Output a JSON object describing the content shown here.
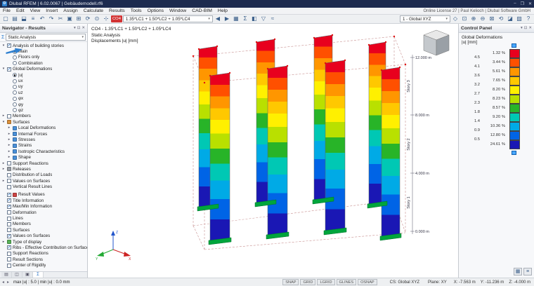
{
  "window": {
    "app_title": "Dlubal RFEM | 6.02.0067 | Gebäudemodell.rf6",
    "logo": "D",
    "minimize": "–",
    "maximize": "❐",
    "close": "✕"
  },
  "menubar": {
    "items": [
      "File",
      "Edit",
      "View",
      "Insert",
      "Assign",
      "Calculate",
      "Results",
      "Tools",
      "Options",
      "Window",
      "CAD-BIM",
      "Help"
    ],
    "license_text": "Online License 27 | Paul Kelioch | Dlubal Software GmbH"
  },
  "toolbar": {
    "left_icons": [
      {
        "name": "new-model",
        "g": "▢"
      },
      {
        "name": "open-model",
        "g": "▤"
      },
      {
        "name": "save-model",
        "g": "⬓"
      },
      {
        "name": "print",
        "g": "≡"
      },
      {
        "name": "undo",
        "g": "↶"
      },
      {
        "name": "redo",
        "g": "↷"
      },
      {
        "name": "cut",
        "g": "✂"
      },
      {
        "name": "copy",
        "g": "▣"
      },
      {
        "name": "table-grid",
        "g": "⊞"
      },
      {
        "name": "refresh",
        "g": "⟳"
      },
      {
        "name": "zoom",
        "g": "⊙"
      },
      {
        "name": "select",
        "g": "⊹"
      }
    ],
    "co_badge": "CO4",
    "load_combination": "1.35*LC1 + 1.50*LC2 + 1.05*LC4",
    "mid_icons": [
      {
        "name": "previous-case",
        "g": "◀"
      },
      {
        "name": "next-case",
        "g": "▶"
      },
      {
        "name": "calculate-all",
        "g": "▦"
      },
      {
        "name": "results-sum",
        "g": "Σ"
      },
      {
        "name": "show-results",
        "g": "◧"
      },
      {
        "name": "result-filter",
        "g": "▽"
      },
      {
        "name": "animation",
        "g": "≈"
      }
    ],
    "view_selector": "1 - Global XYZ",
    "right_icons": [
      {
        "name": "isometric-view",
        "g": "◇"
      },
      {
        "name": "zoom-window",
        "g": "⊡"
      },
      {
        "name": "zoom-in",
        "g": "⊕"
      },
      {
        "name": "zoom-out",
        "g": "⊖"
      },
      {
        "name": "fit-view",
        "g": "⊠"
      },
      {
        "name": "rotate-view",
        "g": "⟲"
      },
      {
        "name": "clipping",
        "g": "◪"
      },
      {
        "name": "render-mode",
        "g": "▨"
      },
      {
        "name": "help",
        "g": "?"
      }
    ]
  },
  "navigator": {
    "title": "Navigator - Results",
    "selector": "Static Analysis",
    "panel_icons": {
      "menu": "▾",
      "pin": "⊡",
      "close": "✕"
    },
    "tree": [
      {
        "t": "Analysis of building stories",
        "i": 0,
        "e": "o",
        "c": "cb1"
      },
      {
        "t": "Main",
        "i": 1,
        "c": "r1",
        "a": true
      },
      {
        "t": "Floors only",
        "i": 1,
        "c": "r0"
      },
      {
        "t": "Combination",
        "i": 1,
        "c": "r0"
      },
      {
        "t": "Global Deformations",
        "i": 0,
        "e": "o",
        "c": "cb1"
      },
      {
        "t": "|u|",
        "i": 1,
        "c": "r1"
      },
      {
        "t": "ux",
        "i": 1,
        "c": "r0"
      },
      {
        "t": "uy",
        "i": 1,
        "c": "r0"
      },
      {
        "t": "uz",
        "i": 1,
        "c": "r0"
      },
      {
        "t": "φx",
        "i": 1,
        "c": "r0"
      },
      {
        "t": "φy",
        "i": 1,
        "c": "r0"
      },
      {
        "t": "φz",
        "i": 1,
        "c": "r0"
      },
      {
        "t": "Members",
        "i": 0,
        "e": "c",
        "c": "cb0"
      },
      {
        "t": "Surfaces",
        "i": 0,
        "e": "o",
        "ic": "#d98f3a"
      },
      {
        "t": "Local Deformations",
        "i": 1,
        "e": "c",
        "ic": "#4a90d9"
      },
      {
        "t": "Internal Forces",
        "i": 1,
        "e": "c",
        "ic": "#4a90d9"
      },
      {
        "t": "Stresses",
        "i": 1,
        "e": "c",
        "ic": "#4a90d9"
      },
      {
        "t": "Strains",
        "i": 1,
        "e": "c",
        "ic": "#4a90d9"
      },
      {
        "t": "Isotropic Characteristics",
        "i": 1,
        "e": "c",
        "ic": "#4a90d9"
      },
      {
        "t": "Shape",
        "i": 1,
        "e": "c",
        "ic": "#4a90d9"
      },
      {
        "t": "Support Reactions",
        "i": 0,
        "e": "c",
        "c": "cb0"
      },
      {
        "t": "Releases",
        "i": 0,
        "e": "c",
        "ic": "#9aa0a8"
      },
      {
        "t": "Distribution of Loads",
        "i": 0,
        "c": "cb0"
      },
      {
        "t": "Values on Surfaces",
        "i": 0,
        "e": "c",
        "c": "cb0"
      },
      {
        "t": "Vertical Result Lines",
        "i": 0,
        "c": "cb0"
      },
      {
        "t": "Result Values",
        "i": 0,
        "c": "cb1",
        "ic": "#cc4444",
        "gap": true
      },
      {
        "t": "Title Information",
        "i": 0,
        "c": "cb1"
      },
      {
        "t": "Max/Min Information",
        "i": 0,
        "c": "cb1"
      },
      {
        "t": "Deformation",
        "i": 0,
        "c": "cb0"
      },
      {
        "t": "Lines",
        "i": 0,
        "c": "cb0"
      },
      {
        "t": "Members",
        "i": 0,
        "c": "cb0"
      },
      {
        "t": "Surfaces",
        "i": 0,
        "c": "cb0"
      },
      {
        "t": "Values on Surfaces",
        "i": 0,
        "c": "cb1"
      },
      {
        "t": "Type of display",
        "i": 0,
        "e": "c",
        "ic": "#57b257"
      },
      {
        "t": "Ribs - Effective Contribution on Surface/Me...",
        "i": 0,
        "c": "cb1"
      },
      {
        "t": "Support Reactions",
        "i": 0,
        "c": "cb0"
      },
      {
        "t": "Result Sections",
        "i": 0,
        "c": "cb0"
      },
      {
        "t": "Center of Rigidity",
        "i": 0,
        "c": "cb0"
      }
    ],
    "bottom_tabs": [
      {
        "name": "data",
        "g": "▤"
      },
      {
        "name": "display",
        "g": "◫"
      },
      {
        "name": "views",
        "g": "▣"
      },
      {
        "name": "results",
        "g": "Σ",
        "active": true
      }
    ]
  },
  "canvas": {
    "info1": "CO4 - 1.35*LC1 + 1.50*LC2 + 1.05*LC4",
    "info2": "Static Analysis",
    "info3": "Displacements |u| [mm]",
    "story_levels": [
      "12.000 m",
      "8.000 m",
      "4.000 m",
      "0.000 m"
    ],
    "story_names": [
      "Story 3",
      "Story 2",
      "Story 1"
    ],
    "axis": {
      "x": "X",
      "y": "Y",
      "z": "Z"
    }
  },
  "control_panel": {
    "title": "Control Panel",
    "subtitle1": "Global Deformations",
    "subtitle2": "|u| [mm]",
    "legend": {
      "colors": [
        "#e8001e",
        "#ff5000",
        "#ff9600",
        "#ffc800",
        "#fff000",
        "#b9e000",
        "#28b428",
        "#00c8b4",
        "#00aae6",
        "#0064e6",
        "#1a17b4"
      ],
      "percentages": [
        "1.32 %",
        "3.44 %",
        "5.61 %",
        "7.65 %",
        "8.20 %",
        "8.23 %",
        "8.57 %",
        "9.20 %",
        "10.36 %",
        "12.80 %",
        "24.61 %"
      ],
      "values": [
        "4.5",
        "4.1",
        "3.6",
        "3.2",
        "2.7",
        "2.3",
        "1.8",
        "1.4",
        "0.9",
        "0.5"
      ]
    },
    "buttons": [
      {
        "name": "panel-options",
        "g": "▦"
      },
      {
        "name": "panel-collapse",
        "g": "≡"
      }
    ]
  },
  "statusbar": {
    "result_info": "max |u| : 5.0 | min |u| : 0.0 mm",
    "toggles": [
      "SNAP",
      "GRID",
      "LGRID",
      "GLINES",
      "OSNAP"
    ],
    "cs": "CS: Global XYZ",
    "plane": "Plane: XY",
    "coords": [
      "X: -7.563 m",
      "Y: -11.236 m",
      "Z: -4.000 m"
    ]
  }
}
